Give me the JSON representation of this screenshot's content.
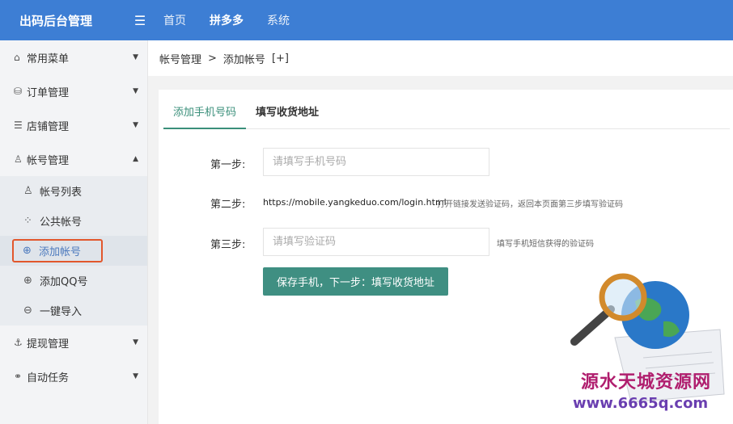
{
  "header": {
    "brand": "出码后台管理",
    "collapse_icon": "menu-collapse-icon",
    "nav": [
      "首页",
      "拼多多",
      "系统"
    ],
    "active_nav": 1
  },
  "sidebar": {
    "items": [
      {
        "icon": "home-icon",
        "label": "常用菜单",
        "arrow": "▼"
      },
      {
        "icon": "database-icon",
        "label": "订单管理",
        "arrow": "▼"
      },
      {
        "icon": "list-icon",
        "label": "店铺管理",
        "arrow": "▼"
      },
      {
        "icon": "user-icon",
        "label": "帐号管理",
        "arrow": "▲",
        "children": [
          {
            "icon": "user-icon",
            "label": "帐号列表"
          },
          {
            "icon": "grid-icon",
            "label": "公共帐号"
          },
          {
            "icon": "plus-circle-icon",
            "label": "添加帐号",
            "active": true
          },
          {
            "icon": "plus-circle-icon",
            "label": "添加QQ号"
          },
          {
            "icon": "import-icon",
            "label": "一键导入"
          }
        ]
      },
      {
        "icon": "anchor-icon",
        "label": "提现管理",
        "arrow": "▼"
      },
      {
        "icon": "link-icon",
        "label": "自动任务",
        "arrow": "▼"
      }
    ]
  },
  "breadcrumb": {
    "parent": "帐号管理",
    "separator": ">",
    "current": "添加帐号",
    "extra": "[+]"
  },
  "tabs": [
    "添加手机号码",
    "填写收货地址"
  ],
  "form": {
    "step1_label": "第一步:",
    "phone_placeholder": "请填写手机号码",
    "step2_label": "第二步:",
    "step2_link": "https://mobile.yangkeduo.com/login.html",
    "step2_hint": "打开链接发送验证码，返回本页面第三步填写验证码",
    "step3_label": "第三步:",
    "code_placeholder": "请填写验证码",
    "step3_hint": "填写手机短信获得的验证码",
    "submit_label": "保存手机，下一步：填写收货地址"
  },
  "watermark": {
    "title": "源水天城资源网",
    "url": "www.6665q.com"
  }
}
